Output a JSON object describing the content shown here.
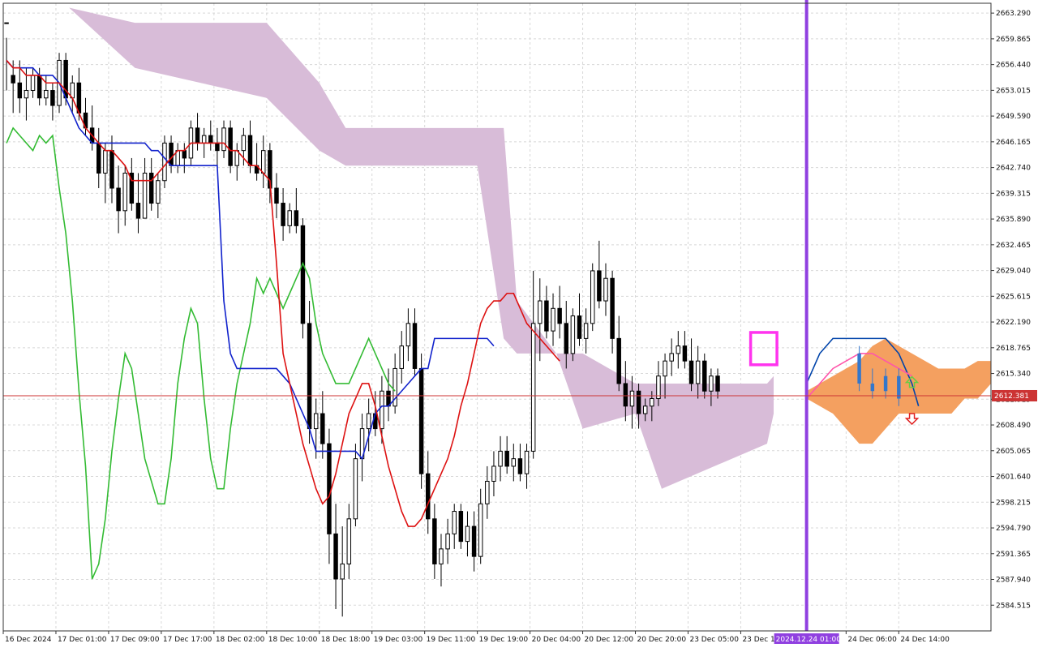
{
  "chart_data": {
    "type": "candlestick",
    "y_axis": {
      "position": "right",
      "ylim": [
        2581.09,
        2664.6
      ],
      "tick_labels": [
        "2663.290",
        "2659.865",
        "2656.440",
        "2653.015",
        "2649.590",
        "2646.165",
        "2642.740",
        "2639.315",
        "2635.890",
        "2632.465",
        "2629.040",
        "2625.615",
        "2622.190",
        "2618.765",
        "2615.340",
        "2611.915",
        "2608.490",
        "2605.065",
        "2601.640",
        "2598.215",
        "2594.790",
        "2591.365",
        "2587.940",
        "2584.515"
      ]
    },
    "x_axis": {
      "bar_count": 150,
      "tick_labels": [
        {
          "label": "16 Dec 2024",
          "bar": 0
        },
        {
          "label": "17 Dec 01:00",
          "bar": 8
        },
        {
          "label": "17 Dec 09:00",
          "bar": 16
        },
        {
          "label": "17 Dec 17:00",
          "bar": 24
        },
        {
          "label": "18 Dec 02:00",
          "bar": 32
        },
        {
          "label": "18 Dec 10:00",
          "bar": 40
        },
        {
          "label": "18 Dec 18:00",
          "bar": 48
        },
        {
          "label": "19 Dec 03:00",
          "bar": 56
        },
        {
          "label": "19 Dec 11:00",
          "bar": 64
        },
        {
          "label": "19 Dec 19:00",
          "bar": 72
        },
        {
          "label": "20 Dec 04:00",
          "bar": 80
        },
        {
          "label": "20 Dec 12:00",
          "bar": 88
        },
        {
          "label": "20 Dec 20:00",
          "bar": 96
        },
        {
          "label": "23 Dec 05:00",
          "bar": 104
        },
        {
          "label": "23 Dec 13:00",
          "bar": 112
        },
        {
          "label": "24 Dec 06:00",
          "bar": 128
        },
        {
          "label": "24 Dec 14:00",
          "bar": 136
        }
      ],
      "highlight_label": {
        "label": "2024.12.24 01:00",
        "bar": 122
      }
    },
    "current_price": {
      "label": "2612.381",
      "value": 2612.381
    },
    "vertical_marker_bar": 122,
    "candles": [
      [
        2662,
        2660,
        2653,
        2662
      ],
      [
        2655,
        2657,
        2650,
        2654
      ],
      [
        2654,
        2657,
        2650,
        2652
      ],
      [
        2652,
        2656,
        2649,
        2653
      ],
      [
        2653,
        2656,
        2652,
        2655
      ],
      [
        2655,
        2656,
        2651,
        2652
      ],
      [
        2652,
        2655,
        2651,
        2653
      ],
      [
        2653,
        2654,
        2649,
        2651
      ],
      [
        2651,
        2658,
        2650,
        2657
      ],
      [
        2657,
        2658,
        2651,
        2652
      ],
      [
        2652,
        2655,
        2650,
        2654
      ],
      [
        2654,
        2656,
        2649,
        2650
      ],
      [
        2650,
        2652,
        2647,
        2648
      ],
      [
        2648,
        2651,
        2645,
        2646
      ],
      [
        2646,
        2648,
        2640,
        2642
      ],
      [
        2642,
        2646,
        2638,
        2645
      ],
      [
        2645,
        2647,
        2638,
        2640
      ],
      [
        2640,
        2643,
        2634,
        2637
      ],
      [
        2637,
        2643,
        2635,
        2642
      ],
      [
        2642,
        2644,
        2637,
        2638
      ],
      [
        2638,
        2642,
        2634,
        2636
      ],
      [
        2636,
        2644,
        2636,
        2642
      ],
      [
        2642,
        2644,
        2637,
        2638
      ],
      [
        2638,
        2642,
        2636,
        2641
      ],
      [
        2641,
        2647,
        2640,
        2646
      ],
      [
        2646,
        2647,
        2642,
        2643
      ],
      [
        2643,
        2646,
        2642,
        2645
      ],
      [
        2645,
        2646,
        2642,
        2644
      ],
      [
        2644,
        2649,
        2643,
        2648
      ],
      [
        2648,
        2650,
        2645,
        2646
      ],
      [
        2646,
        2648,
        2644,
        2647
      ],
      [
        2647,
        2649,
        2645,
        2646
      ],
      [
        2646,
        2648,
        2643,
        2645
      ],
      [
        2645,
        2649,
        2644,
        2648
      ],
      [
        2648,
        2649,
        2642,
        2643
      ],
      [
        2643,
        2646,
        2641,
        2645
      ],
      [
        2645,
        2648,
        2643,
        2647
      ],
      [
        2647,
        2649,
        2642,
        2643
      ],
      [
        2643,
        2646,
        2641,
        2642
      ],
      [
        2642,
        2647,
        2640,
        2645
      ],
      [
        2645,
        2646,
        2638,
        2640
      ],
      [
        2640,
        2642,
        2636,
        2638
      ],
      [
        2638,
        2640,
        2633,
        2635
      ],
      [
        2635,
        2638,
        2634,
        2637
      ],
      [
        2637,
        2640,
        2634,
        2635
      ],
      [
        2635,
        2636,
        2620,
        2622
      ],
      [
        2622,
        2625,
        2606,
        2608
      ],
      [
        2608,
        2612,
        2604,
        2610
      ],
      [
        2610,
        2613,
        2604,
        2606
      ],
      [
        2606,
        2608,
        2590,
        2594
      ],
      [
        2594,
        2598,
        2584,
        2588
      ],
      [
        2588,
        2595,
        2583,
        2590
      ],
      [
        2590,
        2598,
        2588,
        2596
      ],
      [
        2596,
        2606,
        2595,
        2604
      ],
      [
        2604,
        2610,
        2601,
        2608
      ],
      [
        2608,
        2612,
        2605,
        2610
      ],
      [
        2610,
        2613,
        2607,
        2608
      ],
      [
        2608,
        2615,
        2606,
        2613
      ],
      [
        2613,
        2616,
        2609,
        2611
      ],
      [
        2611,
        2618,
        2610,
        2616
      ],
      [
        2616,
        2621,
        2614,
        2619
      ],
      [
        2619,
        2624,
        2617,
        2622
      ],
      [
        2622,
        2624,
        2615,
        2616
      ],
      [
        2616,
        2618,
        2600,
        2602
      ],
      [
        2602,
        2605,
        2594,
        2596
      ],
      [
        2596,
        2598,
        2588,
        2590
      ],
      [
        2590,
        2594,
        2587,
        2592
      ],
      [
        2592,
        2596,
        2590,
        2594
      ],
      [
        2594,
        2598,
        2592,
        2597
      ],
      [
        2597,
        2598,
        2592,
        2593
      ],
      [
        2593,
        2597,
        2591,
        2595
      ],
      [
        2595,
        2597,
        2589,
        2591
      ],
      [
        2591,
        2600,
        2590,
        2598
      ],
      [
        2598,
        2603,
        2596,
        2601
      ],
      [
        2601,
        2605,
        2599,
        2603
      ],
      [
        2603,
        2607,
        2601,
        2605
      ],
      [
        2605,
        2607,
        2602,
        2603
      ],
      [
        2603,
        2606,
        2601,
        2604
      ],
      [
        2604,
        2606,
        2601,
        2602
      ],
      [
        2602,
        2606,
        2600,
        2605
      ],
      [
        2605,
        2629,
        2604,
        2622
      ],
      [
        2622,
        2628,
        2617,
        2625
      ],
      [
        2625,
        2627,
        2620,
        2621
      ],
      [
        2621,
        2626,
        2619,
        2624
      ],
      [
        2624,
        2627,
        2620,
        2622
      ],
      [
        2622,
        2625,
        2616,
        2618
      ],
      [
        2618,
        2624,
        2617,
        2623
      ],
      [
        2623,
        2626,
        2619,
        2620
      ],
      [
        2620,
        2624,
        2618,
        2622
      ],
      [
        2622,
        2630,
        2621,
        2629
      ],
      [
        2629,
        2633,
        2624,
        2625
      ],
      [
        2625,
        2630,
        2623,
        2628
      ],
      [
        2628,
        2629,
        2618,
        2620
      ],
      [
        2620,
        2623,
        2613,
        2614
      ],
      [
        2614,
        2617,
        2609,
        2611
      ],
      [
        2611,
        2615,
        2608,
        2613
      ],
      [
        2613,
        2614,
        2608,
        2610
      ],
      [
        2610,
        2612,
        2609,
        2611
      ],
      [
        2611,
        2613,
        2609,
        2612
      ],
      [
        2612,
        2617,
        2611,
        2615
      ],
      [
        2615,
        2618,
        2612,
        2617
      ],
      [
        2617,
        2620,
        2615,
        2618
      ],
      [
        2618,
        2621,
        2616,
        2619
      ],
      [
        2619,
        2621,
        2616,
        2617
      ],
      [
        2617,
        2620,
        2613,
        2614
      ],
      [
        2614,
        2619,
        2612,
        2617
      ],
      [
        2617,
        2618,
        2612,
        2613
      ],
      [
        2613,
        2616,
        2611,
        2615
      ],
      [
        2615,
        2616,
        2612,
        2613
      ]
    ],
    "ichimoku": {
      "tenkan_sen": [
        2657,
        2656,
        2656,
        2655,
        2655,
        2655,
        2654,
        2654,
        2654,
        2653,
        2652,
        2650,
        2648,
        2647,
        2646,
        2645,
        2645,
        2644,
        2643,
        2641,
        2641,
        2641,
        2641,
        2642,
        2643,
        2644,
        2645,
        2645,
        2646,
        2646,
        2646,
        2646,
        2646,
        2646,
        2645,
        2645,
        2644,
        2643,
        2643,
        2642,
        2641,
        2630,
        2618,
        2614,
        2610,
        2606,
        2603,
        2600,
        2598,
        2599,
        2602,
        2606,
        2610,
        2612,
        2614,
        2614,
        2611,
        2607,
        2603,
        2600,
        2597,
        2595,
        2595,
        2596,
        2598,
        2600,
        2602,
        2604,
        2607,
        2611,
        2614,
        2618,
        2622,
        2624,
        2625,
        2625,
        2626,
        2626,
        2624,
        2622,
        2621,
        2620,
        2619,
        2618,
        2617
      ],
      "kijun_sen": [
        2657,
        2656,
        2656,
        2656,
        2656,
        2655,
        2655,
        2655,
        2654,
        2652,
        2650,
        2648,
        2647,
        2646,
        2646,
        2646,
        2646,
        2646,
        2646,
        2646,
        2646,
        2646,
        2645,
        2645,
        2644,
        2643,
        2643,
        2643,
        2643,
        2643,
        2643,
        2643,
        2643,
        2625,
        2618,
        2616,
        2616,
        2616,
        2616,
        2616,
        2616,
        2616,
        2615,
        2614,
        2612,
        2610,
        2608,
        2605,
        2605,
        2605,
        2605,
        2605,
        2605,
        2605,
        2604,
        2607,
        2610,
        2611,
        2611,
        2612,
        2613,
        2614,
        2615,
        2616,
        2616,
        2620,
        2620,
        2620,
        2620,
        2620,
        2620,
        2620,
        2620,
        2620,
        2619
      ],
      "chikou_span": [
        2646,
        2648,
        2647,
        2646,
        2645,
        2647,
        2646,
        2647,
        2640,
        2634,
        2625,
        2613,
        2603,
        2588,
        2590,
        2596,
        2605,
        2612,
        2618,
        2616,
        2610,
        2604,
        2601,
        2598,
        2598,
        2604,
        2614,
        2620,
        2624,
        2622,
        2612,
        2604,
        2600,
        2600,
        2608,
        2614,
        2618,
        2622,
        2628,
        2626,
        2628,
        2626,
        2624,
        2626,
        2628,
        2630,
        2628,
        2622,
        2618,
        2616,
        2614,
        2614,
        2614,
        2616,
        2618,
        2620,
        2618,
        2616,
        2614,
        2613
      ]
    },
    "cloud": [
      {
        "bar": 10,
        "a": 2664,
        "b": 2664
      },
      {
        "bar": 20,
        "a": 2656,
        "b": 2662
      },
      {
        "bar": 30,
        "a": 2654,
        "b": 2662
      },
      {
        "bar": 40,
        "a": 2652,
        "b": 2662
      },
      {
        "bar": 48,
        "a": 2645,
        "b": 2654
      },
      {
        "bar": 52,
        "a": 2643,
        "b": 2648
      },
      {
        "bar": 60,
        "a": 2643,
        "b": 2648
      },
      {
        "bar": 72,
        "a": 2643,
        "b": 2648
      },
      {
        "bar": 76,
        "a": 2620,
        "b": 2648
      },
      {
        "bar": 78,
        "a": 2618,
        "b": 2625
      },
      {
        "bar": 84,
        "a": 2618,
        "b": 2618
      },
      {
        "bar": 88,
        "a": 2608,
        "b": 2618
      },
      {
        "bar": 96,
        "a": 2610,
        "b": 2614
      },
      {
        "bar": 100,
        "a": 2600,
        "b": 2614
      },
      {
        "bar": 108,
        "a": 2603,
        "b": 2614
      },
      {
        "bar": 116,
        "a": 2606,
        "b": 2614
      },
      {
        "bar": 117,
        "a": 2610,
        "b": 2615
      }
    ],
    "future_cloud": [
      {
        "bar": 122,
        "a": 2613,
        "b": 2612
      },
      {
        "bar": 126,
        "a": 2615,
        "b": 2610
      },
      {
        "bar": 130,
        "a": 2617,
        "b": 2606
      },
      {
        "bar": 132,
        "a": 2619,
        "b": 2606
      },
      {
        "bar": 134,
        "a": 2620,
        "b": 2608
      },
      {
        "bar": 136,
        "a": 2619,
        "b": 2610
      },
      {
        "bar": 138,
        "a": 2618,
        "b": 2610
      },
      {
        "bar": 140,
        "a": 2617,
        "b": 2610
      },
      {
        "bar": 142,
        "a": 2616,
        "b": 2610
      },
      {
        "bar": 144,
        "a": 2616,
        "b": 2610
      },
      {
        "bar": 146,
        "a": 2616,
        "b": 2612
      },
      {
        "bar": 148,
        "a": 2617,
        "b": 2612
      },
      {
        "bar": 150,
        "a": 2617,
        "b": 2614
      }
    ],
    "forecast": {
      "blue_line": [
        [
          122,
          2614
        ],
        [
          124,
          2618
        ],
        [
          126,
          2620
        ],
        [
          128,
          2620
        ],
        [
          130,
          2620
        ],
        [
          132,
          2620
        ],
        [
          134,
          2620
        ],
        [
          136,
          2618
        ],
        [
          138,
          2614
        ],
        [
          139,
          2611
        ]
      ],
      "pink_line": [
        [
          122,
          2612
        ],
        [
          124,
          2614
        ],
        [
          126,
          2616
        ],
        [
          128,
          2617
        ],
        [
          130,
          2618
        ],
        [
          132,
          2618
        ],
        [
          134,
          2617
        ],
        [
          136,
          2616
        ],
        [
          138,
          2615
        ]
      ],
      "candles": [
        [
          130,
          2618,
          2619,
          2613,
          2614
        ],
        [
          132,
          2614,
          2616,
          2612,
          2613
        ],
        [
          134,
          2613,
          2616,
          2612,
          2615
        ],
        [
          136,
          2615,
          2616,
          2611,
          2612
        ]
      ],
      "up_arrow": {
        "bar": 138,
        "value": 2613.5,
        "color": "#66cc44"
      },
      "down_arrow": {
        "bar": 138,
        "value": 2610,
        "color": "#e02020"
      }
    },
    "highlight_box": {
      "bar0": 113.5,
      "bar1": 117.5,
      "y0": 2616.5,
      "y1": 2620.8,
      "color": "#ff33ee"
    },
    "colors": {
      "bull": "#ffffff",
      "bear": "#000000",
      "tenkan": "#dd1111",
      "kijun": "#1122cc",
      "chikou": "#33bb33",
      "cloud": "#d8bcd8",
      "future_cloud": "#f4a060",
      "vertical_marker": "#9040e0",
      "price_line": "#cc3333",
      "price_label_bg": "#cc3333",
      "forecast_pink": "#ff55aa",
      "forecast_blue": "#0044aa",
      "forecast_candle": "#3377cc"
    }
  }
}
